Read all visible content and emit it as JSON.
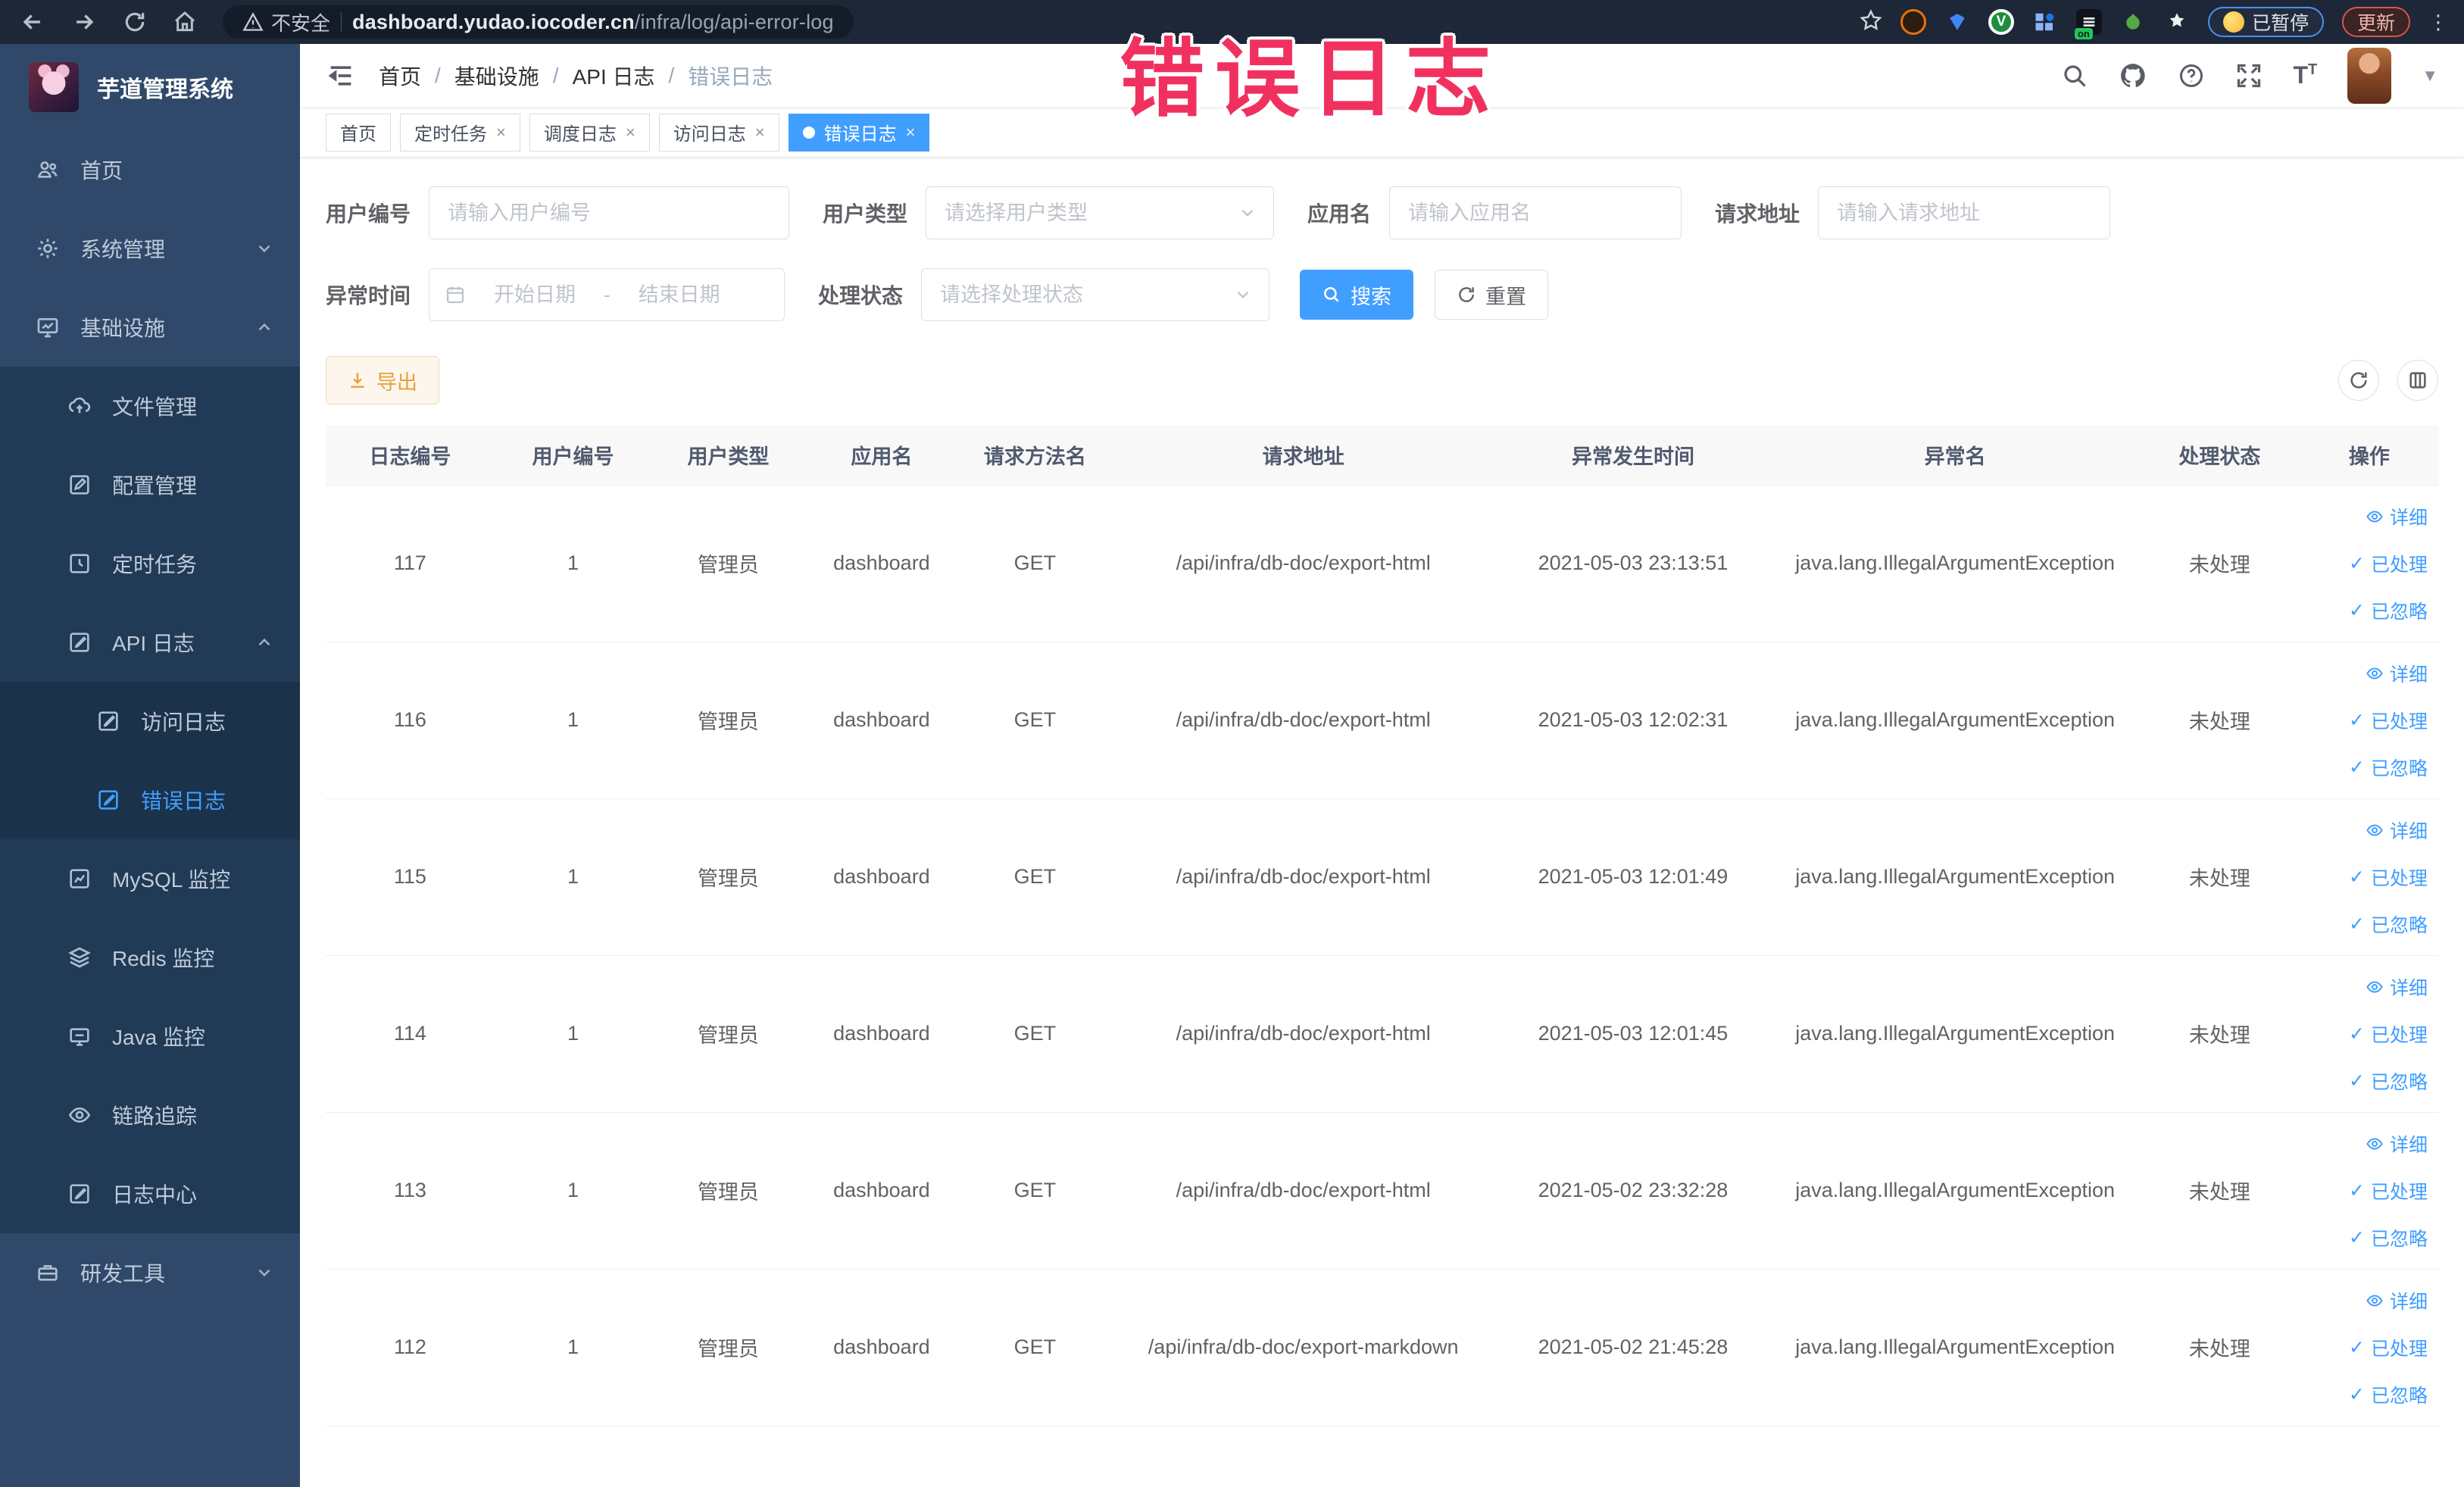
{
  "browser": {
    "security_label": "不安全",
    "url_domain": "dashboard.yudao.iocoder.cn",
    "url_path": "/infra/log/api-error-log",
    "paused_label": "已暂停",
    "update_label": "更新",
    "on_badge": "on"
  },
  "watermark": "错误日志",
  "sidebar": {
    "title": "芋道管理系统",
    "items": [
      {
        "label": "首页"
      },
      {
        "label": "系统管理"
      },
      {
        "label": "基础设施"
      },
      {
        "label": "文件管理"
      },
      {
        "label": "配置管理"
      },
      {
        "label": "定时任务"
      },
      {
        "label": "API 日志"
      },
      {
        "label": "访问日志"
      },
      {
        "label": "错误日志"
      },
      {
        "label": "MySQL 监控"
      },
      {
        "label": "Redis 监控"
      },
      {
        "label": "Java 监控"
      },
      {
        "label": "链路追踪"
      },
      {
        "label": "日志中心"
      },
      {
        "label": "研发工具"
      }
    ]
  },
  "breadcrumb": {
    "items": [
      "首页",
      "基础设施",
      "API 日志",
      "错误日志"
    ]
  },
  "tabs": [
    {
      "label": "首页"
    },
    {
      "label": "定时任务"
    },
    {
      "label": "调度日志"
    },
    {
      "label": "访问日志"
    },
    {
      "label": "错误日志"
    }
  ],
  "filters": {
    "user_id": {
      "label": "用户编号",
      "placeholder": "请输入用户编号"
    },
    "user_type": {
      "label": "用户类型",
      "placeholder": "请选择用户类型"
    },
    "app_name": {
      "label": "应用名",
      "placeholder": "请输入应用名"
    },
    "request_url": {
      "label": "请求地址",
      "placeholder": "请输入请求地址"
    },
    "exception_time": {
      "label": "异常时间",
      "start_placeholder": "开始日期",
      "separator": "-",
      "end_placeholder": "结束日期"
    },
    "process_status": {
      "label": "处理状态",
      "placeholder": "请选择处理状态"
    },
    "search_label": "搜索",
    "reset_label": "重置"
  },
  "toolbar": {
    "export_label": "导出"
  },
  "table": {
    "columns": [
      "日志编号",
      "用户编号",
      "用户类型",
      "应用名",
      "请求方法名",
      "请求地址",
      "异常发生时间",
      "异常名",
      "处理状态",
      "操作"
    ],
    "actions": [
      "详细",
      "已处理",
      "已忽略"
    ],
    "rows": [
      {
        "id": "117",
        "user_id": "1",
        "user_type": "管理员",
        "app": "dashboard",
        "method": "GET",
        "url": "/api/infra/db-doc/export-html",
        "time": "2021-05-03 23:13:51",
        "exception": "java.lang.IllegalArgumentException",
        "status": "未处理"
      },
      {
        "id": "116",
        "user_id": "1",
        "user_type": "管理员",
        "app": "dashboard",
        "method": "GET",
        "url": "/api/infra/db-doc/export-html",
        "time": "2021-05-03 12:02:31",
        "exception": "java.lang.IllegalArgumentException",
        "status": "未处理"
      },
      {
        "id": "115",
        "user_id": "1",
        "user_type": "管理员",
        "app": "dashboard",
        "method": "GET",
        "url": "/api/infra/db-doc/export-html",
        "time": "2021-05-03 12:01:49",
        "exception": "java.lang.IllegalArgumentException",
        "status": "未处理"
      },
      {
        "id": "114",
        "user_id": "1",
        "user_type": "管理员",
        "app": "dashboard",
        "method": "GET",
        "url": "/api/infra/db-doc/export-html",
        "time": "2021-05-03 12:01:45",
        "exception": "java.lang.IllegalArgumentException",
        "status": "未处理"
      },
      {
        "id": "113",
        "user_id": "1",
        "user_type": "管理员",
        "app": "dashboard",
        "method": "GET",
        "url": "/api/infra/db-doc/export-html",
        "time": "2021-05-02 23:32:28",
        "exception": "java.lang.IllegalArgumentException",
        "status": "未处理"
      },
      {
        "id": "112",
        "user_id": "1",
        "user_type": "管理员",
        "app": "dashboard",
        "method": "GET",
        "url": "/api/infra/db-doc/export-markdown",
        "time": "2021-05-02 21:45:28",
        "exception": "java.lang.IllegalArgumentException",
        "status": "未处理"
      }
    ]
  },
  "colors": {
    "accent": "#409eff",
    "warning": "#e6a23c",
    "watermark": "#f0315f",
    "sidebar_bg": "#30496b",
    "sidebar_child_bg": "#213a56",
    "sidebar_grandchild_bg": "#1b324b",
    "chrome_bg": "#1d2737"
  }
}
